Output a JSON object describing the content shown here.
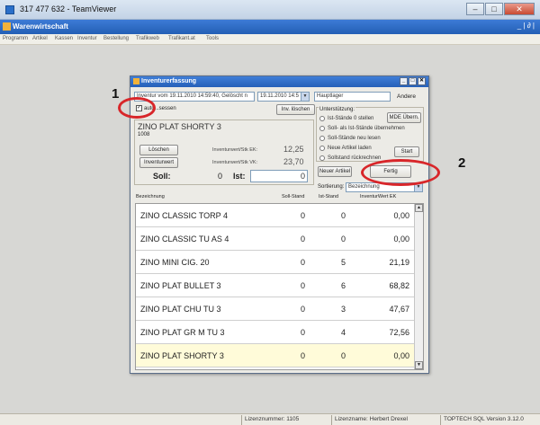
{
  "teamviewer": {
    "title": "317 477 632 - TeamViewer"
  },
  "app": {
    "title": "Warenwirtschaft",
    "window_controls": "_ | ∂ |"
  },
  "menu": [
    "Programm",
    "Artikel",
    "Kassen",
    "Inventur",
    "Bestellung",
    "Trafikweb",
    "Trafikant.at",
    "Tools"
  ],
  "status": {
    "lizenz_nr": "Lizenznummer: 1105",
    "lizenz_name": "Lizenzname: Herbert Drexel",
    "version": "TOPTECH SQL Version 3.12.0"
  },
  "dialog": {
    "title": "Inventurerfassung",
    "inventur_select": "Inventur vom 19.11.2010 14:59:40, Gelöscht n",
    "date_select": "19.11.2010 14:5",
    "lager_field": "Hauptlager",
    "andere_button": "Andere",
    "auto_checkbox_label": "auto...sessen",
    "inv_loeschen_button": "Inv. löschen",
    "unterstuetzung_label": "Unterstützung:",
    "options": [
      "Ist-Stände 0 stellen",
      "Soll- als Ist-Stände übernehmen",
      "Soll-Stände neu lesen",
      "Neue Artikel laden",
      "Sollstand rückrechnen"
    ],
    "mde_button": "MDE Übern.",
    "start_button": "Start",
    "neuer_artikel_button": "Neuer Artikel",
    "fertig_button": "Fertig",
    "sortierung_label": "Sortierung:",
    "sortierung_value": "Bezeichnung",
    "article": {
      "name": "ZINO PLAT SHORTY  3",
      "number": "1008",
      "loeschen_button": "Löschen",
      "inventurwert_button": "Inventurwert",
      "ek_label": "Inventurwert/Stk EK:",
      "ek_value": "12,25",
      "vk_label": "Inventurwert/Stk VK:",
      "vk_value": "23,70",
      "soll_label": "Soll:",
      "soll_value": "0",
      "ist_label": "Ist:",
      "ist_value": "0"
    },
    "columns": {
      "bezeichnung": "Bezeichnung",
      "soll": "Soll-Stand",
      "ist": "Ist-Stand",
      "wert": "InventurWert EK"
    },
    "rows": [
      {
        "name": "ZINO CLASSIC TORP 4",
        "soll": "0",
        "ist": "0",
        "wert": "0,00"
      },
      {
        "name": "ZINO CLASSIC TU AS 4",
        "soll": "0",
        "ist": "0",
        "wert": "0,00"
      },
      {
        "name": "ZINO MINI CIG. 20",
        "soll": "0",
        "ist": "5",
        "wert": "21,19"
      },
      {
        "name": "ZINO PLAT BULLET  3",
        "soll": "0",
        "ist": "6",
        "wert": "68,82"
      },
      {
        "name": "ZINO PLAT CHU TU  3",
        "soll": "0",
        "ist": "3",
        "wert": "47,67"
      },
      {
        "name": "ZINO PLAT GR M TU  3",
        "soll": "0",
        "ist": "4",
        "wert": "72,56"
      },
      {
        "name": "ZINO PLAT SHORTY  3",
        "soll": "0",
        "ist": "0",
        "wert": "0,00"
      }
    ]
  },
  "annotations": {
    "one": "1",
    "two": "2"
  },
  "colors": {
    "annotation": "#d8262a",
    "title_blue": "#2660b8",
    "selected_row": "#fffbd9"
  }
}
